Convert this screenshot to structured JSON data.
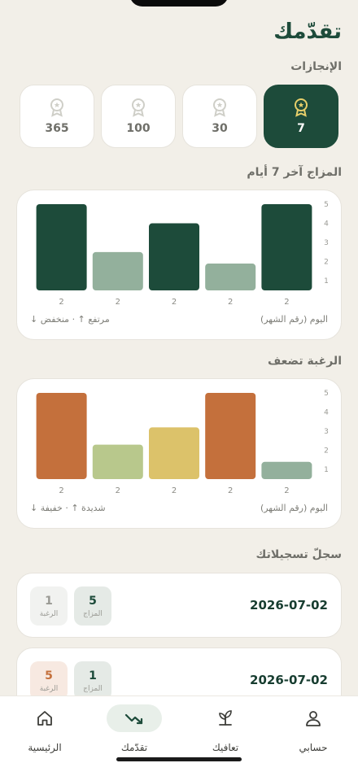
{
  "page": {
    "title": "تقدّمك"
  },
  "achievements": {
    "title": "الإنجازات",
    "items": [
      {
        "value": "7",
        "active": true
      },
      {
        "value": "30",
        "active": false
      },
      {
        "value": "100",
        "active": false
      },
      {
        "value": "365",
        "active": false
      }
    ]
  },
  "mood_chart": {
    "title": "المزاج آخر 7 أيام",
    "footer_axis": "اليوم (رقم الشهر)",
    "footer_legend": "مرتفع ↑ · منخفض ↓"
  },
  "craving_chart": {
    "title": "الرغبة تضعف",
    "footer_axis": "اليوم (رقم الشهر)",
    "footer_legend": "شديدة ↑ · خفيفة ↓"
  },
  "chart_data": [
    {
      "type": "bar",
      "categories": [
        "2",
        "2",
        "2",
        "2",
        "2"
      ],
      "values": [
        5,
        2.5,
        4,
        1.9,
        5
      ],
      "yticks": [
        "1",
        "2",
        "3",
        "4",
        "5"
      ],
      "ylim": [
        0.5,
        5
      ],
      "colors": [
        "#1d4b3a",
        "#93b09c",
        "#1d4b3a",
        "#93b09c",
        "#1d4b3a"
      ]
    },
    {
      "type": "bar",
      "categories": [
        "2",
        "2",
        "2",
        "2",
        "2"
      ],
      "values": [
        5,
        2.3,
        3.2,
        5,
        1.4
      ],
      "yticks": [
        "1",
        "2",
        "3",
        "4",
        "5"
      ],
      "ylim": [
        0.5,
        5
      ],
      "colors": [
        "#c4703c",
        "#b8c88c",
        "#dcc26a",
        "#c4703c",
        "#93b09c"
      ]
    }
  ],
  "logs": {
    "title": "سجلّ تسجيلاتك",
    "mood_label": "المزاج",
    "craving_label": "الرغبة",
    "entries": [
      {
        "date": "2026-07-02",
        "mood": "5",
        "craving": "1"
      },
      {
        "date": "2026-07-02",
        "mood": "1",
        "craving": "5"
      }
    ]
  },
  "nav": {
    "items": [
      {
        "label": "الرئيسية",
        "icon": "home-icon"
      },
      {
        "label": "تقدّمك",
        "icon": "trend-icon",
        "active": true
      },
      {
        "label": "تعافيك",
        "icon": "sprout-icon"
      },
      {
        "label": "حسابي",
        "icon": "user-icon"
      }
    ]
  },
  "colors": {
    "primary": "#1d4b3a",
    "background": "#f2efe8",
    "accent_orange": "#c4703c"
  }
}
